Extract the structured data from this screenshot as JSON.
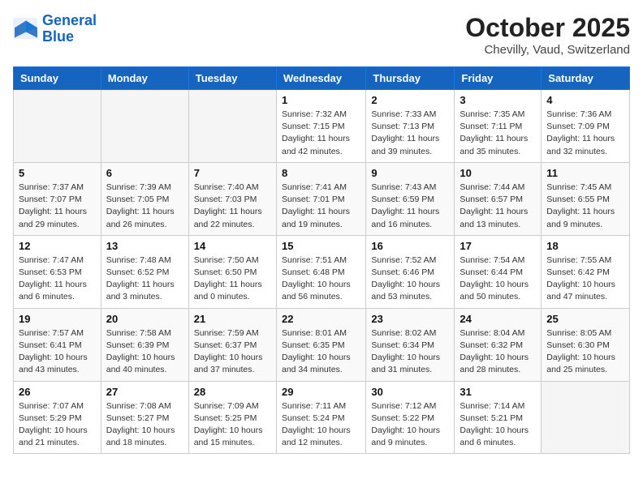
{
  "header": {
    "logo_line1": "General",
    "logo_line2": "Blue",
    "month": "October 2025",
    "location": "Chevilly, Vaud, Switzerland"
  },
  "weekdays": [
    "Sunday",
    "Monday",
    "Tuesday",
    "Wednesday",
    "Thursday",
    "Friday",
    "Saturday"
  ],
  "weeks": [
    [
      {
        "day": "",
        "info": ""
      },
      {
        "day": "",
        "info": ""
      },
      {
        "day": "",
        "info": ""
      },
      {
        "day": "1",
        "info": "Sunrise: 7:32 AM\nSunset: 7:15 PM\nDaylight: 11 hours\nand 42 minutes."
      },
      {
        "day": "2",
        "info": "Sunrise: 7:33 AM\nSunset: 7:13 PM\nDaylight: 11 hours\nand 39 minutes."
      },
      {
        "day": "3",
        "info": "Sunrise: 7:35 AM\nSunset: 7:11 PM\nDaylight: 11 hours\nand 35 minutes."
      },
      {
        "day": "4",
        "info": "Sunrise: 7:36 AM\nSunset: 7:09 PM\nDaylight: 11 hours\nand 32 minutes."
      }
    ],
    [
      {
        "day": "5",
        "info": "Sunrise: 7:37 AM\nSunset: 7:07 PM\nDaylight: 11 hours\nand 29 minutes."
      },
      {
        "day": "6",
        "info": "Sunrise: 7:39 AM\nSunset: 7:05 PM\nDaylight: 11 hours\nand 26 minutes."
      },
      {
        "day": "7",
        "info": "Sunrise: 7:40 AM\nSunset: 7:03 PM\nDaylight: 11 hours\nand 22 minutes."
      },
      {
        "day": "8",
        "info": "Sunrise: 7:41 AM\nSunset: 7:01 PM\nDaylight: 11 hours\nand 19 minutes."
      },
      {
        "day": "9",
        "info": "Sunrise: 7:43 AM\nSunset: 6:59 PM\nDaylight: 11 hours\nand 16 minutes."
      },
      {
        "day": "10",
        "info": "Sunrise: 7:44 AM\nSunset: 6:57 PM\nDaylight: 11 hours\nand 13 minutes."
      },
      {
        "day": "11",
        "info": "Sunrise: 7:45 AM\nSunset: 6:55 PM\nDaylight: 11 hours\nand 9 minutes."
      }
    ],
    [
      {
        "day": "12",
        "info": "Sunrise: 7:47 AM\nSunset: 6:53 PM\nDaylight: 11 hours\nand 6 minutes."
      },
      {
        "day": "13",
        "info": "Sunrise: 7:48 AM\nSunset: 6:52 PM\nDaylight: 11 hours\nand 3 minutes."
      },
      {
        "day": "14",
        "info": "Sunrise: 7:50 AM\nSunset: 6:50 PM\nDaylight: 11 hours\nand 0 minutes."
      },
      {
        "day": "15",
        "info": "Sunrise: 7:51 AM\nSunset: 6:48 PM\nDaylight: 10 hours\nand 56 minutes."
      },
      {
        "day": "16",
        "info": "Sunrise: 7:52 AM\nSunset: 6:46 PM\nDaylight: 10 hours\nand 53 minutes."
      },
      {
        "day": "17",
        "info": "Sunrise: 7:54 AM\nSunset: 6:44 PM\nDaylight: 10 hours\nand 50 minutes."
      },
      {
        "day": "18",
        "info": "Sunrise: 7:55 AM\nSunset: 6:42 PM\nDaylight: 10 hours\nand 47 minutes."
      }
    ],
    [
      {
        "day": "19",
        "info": "Sunrise: 7:57 AM\nSunset: 6:41 PM\nDaylight: 10 hours\nand 43 minutes."
      },
      {
        "day": "20",
        "info": "Sunrise: 7:58 AM\nSunset: 6:39 PM\nDaylight: 10 hours\nand 40 minutes."
      },
      {
        "day": "21",
        "info": "Sunrise: 7:59 AM\nSunset: 6:37 PM\nDaylight: 10 hours\nand 37 minutes."
      },
      {
        "day": "22",
        "info": "Sunrise: 8:01 AM\nSunset: 6:35 PM\nDaylight: 10 hours\nand 34 minutes."
      },
      {
        "day": "23",
        "info": "Sunrise: 8:02 AM\nSunset: 6:34 PM\nDaylight: 10 hours\nand 31 minutes."
      },
      {
        "day": "24",
        "info": "Sunrise: 8:04 AM\nSunset: 6:32 PM\nDaylight: 10 hours\nand 28 minutes."
      },
      {
        "day": "25",
        "info": "Sunrise: 8:05 AM\nSunset: 6:30 PM\nDaylight: 10 hours\nand 25 minutes."
      }
    ],
    [
      {
        "day": "26",
        "info": "Sunrise: 7:07 AM\nSunset: 5:29 PM\nDaylight: 10 hours\nand 21 minutes."
      },
      {
        "day": "27",
        "info": "Sunrise: 7:08 AM\nSunset: 5:27 PM\nDaylight: 10 hours\nand 18 minutes."
      },
      {
        "day": "28",
        "info": "Sunrise: 7:09 AM\nSunset: 5:25 PM\nDaylight: 10 hours\nand 15 minutes."
      },
      {
        "day": "29",
        "info": "Sunrise: 7:11 AM\nSunset: 5:24 PM\nDaylight: 10 hours\nand 12 minutes."
      },
      {
        "day": "30",
        "info": "Sunrise: 7:12 AM\nSunset: 5:22 PM\nDaylight: 10 hours\nand 9 minutes."
      },
      {
        "day": "31",
        "info": "Sunrise: 7:14 AM\nSunset: 5:21 PM\nDaylight: 10 hours\nand 6 minutes."
      },
      {
        "day": "",
        "info": ""
      }
    ]
  ]
}
